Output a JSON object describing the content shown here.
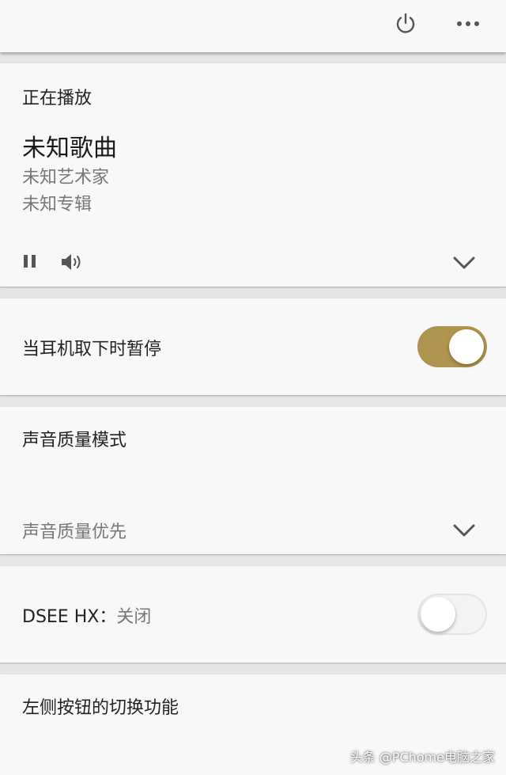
{
  "topbar": {
    "icons": [
      "power-icon",
      "more-options-icon"
    ]
  },
  "now_playing": {
    "header": "正在播放",
    "song": "未知歌曲",
    "artist": "未知艺术家",
    "album": "未知专辑",
    "icons": [
      "pause-icon",
      "volume-icon",
      "chevron-down-icon"
    ]
  },
  "headphone_pause": {
    "label": "当耳机取下时暂停",
    "enabled": true
  },
  "sound_quality": {
    "label": "声音质量模式",
    "value": "声音质量优先"
  },
  "dsee": {
    "label": "DSEE HX：",
    "value": "关闭",
    "enabled": false
  },
  "left_button": {
    "label": "左侧按钮的切换功能"
  },
  "watermark": "头条 @PChome电脑之家",
  "colors": {
    "accent": "#ae944e",
    "card": "#f8f8f8",
    "background": "#e7e7e7"
  }
}
